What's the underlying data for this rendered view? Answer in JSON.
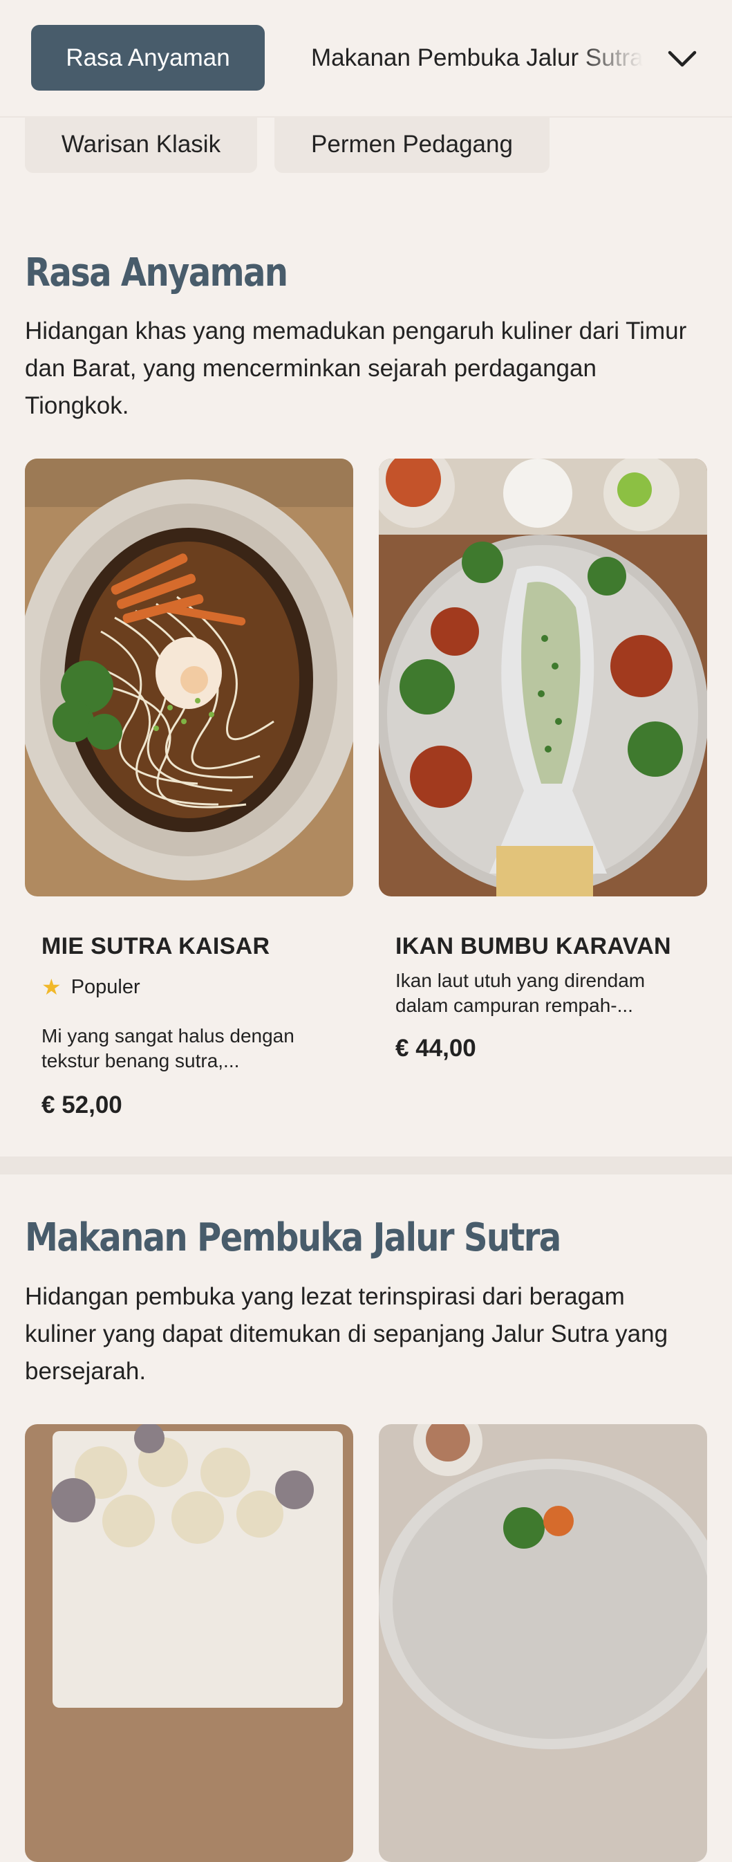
{
  "nav": {
    "active_tab": "Rasa Anyaman",
    "next_tab": "Makanan Pembuka Jalur Sutra",
    "chevron_icon": "chevron-down-icon",
    "chips": [
      "Warisan Klasik",
      "Permen Pedagang"
    ]
  },
  "sections": [
    {
      "title": "Rasa Anyaman",
      "description": "Hidangan khas yang memadukan pengaruh kuliner dari Timur dan Barat, yang mencerminkan sejarah perdagangan Tiongkok.",
      "items": [
        {
          "name": "MIE SUTRA KAISAR",
          "badge": "Populer",
          "badge_icon": "star-icon",
          "description": "Mi yang sangat halus dengan tekstur benang sutra,...",
          "price": "€ 52,00"
        },
        {
          "name": "IKAN BUMBU KARAVAN",
          "description": "Ikan laut utuh yang direndam dalam campuran rempah-...",
          "price": "€ 44,00"
        }
      ]
    },
    {
      "title": "Makanan Pembuka Jalur Sutra",
      "description": "Hidangan pembuka yang lezat terinspirasi dari beragam kuliner yang dapat ditemukan di sepanjang Jalur Sutra yang bersejarah."
    }
  ],
  "colors": {
    "background": "#f5f0ec",
    "accent": "#485c6b",
    "chip": "#ece6e1",
    "star": "#f1b82a"
  }
}
